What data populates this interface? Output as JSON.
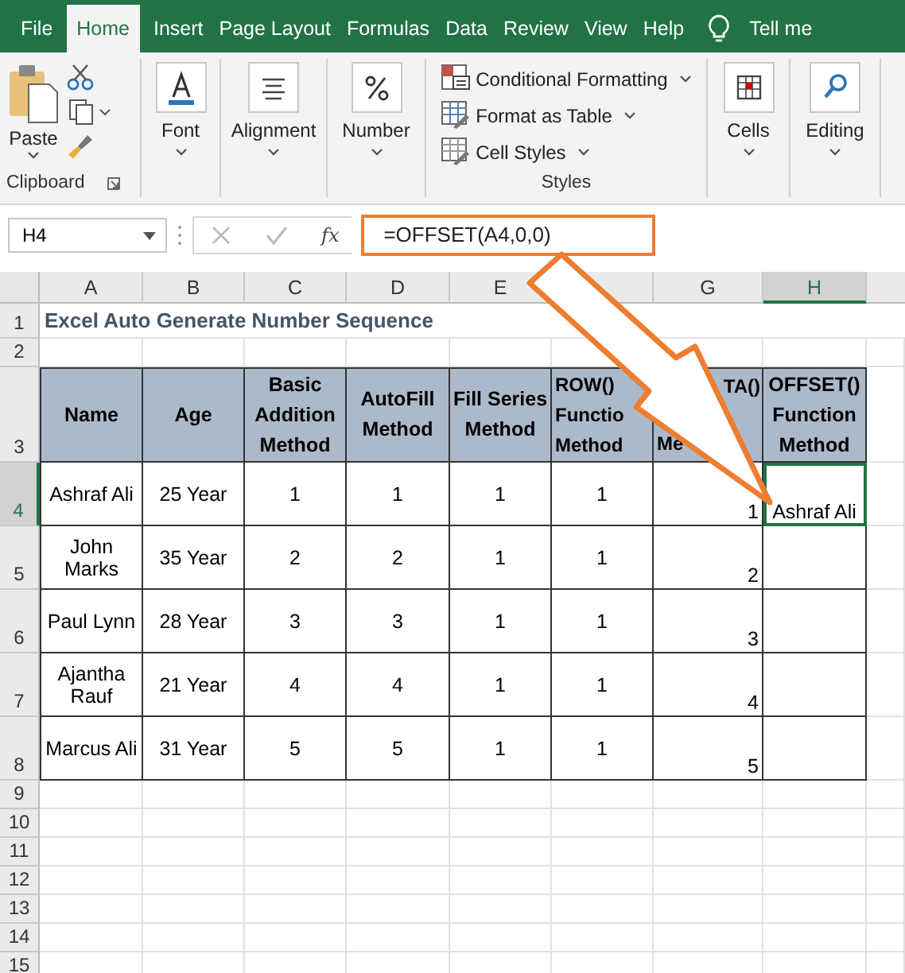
{
  "tabs": [
    {
      "label": "File",
      "selected": false
    },
    {
      "label": "Home",
      "selected": true
    },
    {
      "label": "Insert",
      "selected": false
    },
    {
      "label": "Page Layout",
      "selected": false
    },
    {
      "label": "Formulas",
      "selected": false
    },
    {
      "label": "Data",
      "selected": false
    },
    {
      "label": "Review",
      "selected": false
    },
    {
      "label": "View",
      "selected": false
    },
    {
      "label": "Help",
      "selected": false
    }
  ],
  "tell_me": "Tell me",
  "ribbon": [
    {
      "kind": "clipboard",
      "label": "Clipboard",
      "button": "Paste"
    },
    {
      "kind": "font",
      "label": "Font"
    },
    {
      "kind": "alignment",
      "label": "Alignment"
    },
    {
      "kind": "number",
      "label": "Number"
    },
    {
      "kind": "styles",
      "label": "Styles",
      "items": [
        "Conditional Formatting",
        "Format as Table",
        "Cell Styles"
      ]
    },
    {
      "kind": "cells",
      "label": "Cells"
    },
    {
      "kind": "editing",
      "label": "Editing"
    }
  ],
  "formula_bar": {
    "name_box": "H4",
    "function_label": "fx",
    "formula": "=OFFSET(A4,0,0)"
  },
  "columns": [
    {
      "label": "A",
      "selected": false
    },
    {
      "label": "B",
      "selected": false
    },
    {
      "label": "C",
      "selected": false
    },
    {
      "label": "D",
      "selected": false
    },
    {
      "label": "E",
      "selected": false
    },
    {
      "selected": false
    },
    {
      "label": "G",
      "selected": false
    },
    {
      "label": "H",
      "selected": true
    }
  ],
  "rows": [
    {
      "number": "1",
      "kind": "title",
      "selected": false,
      "title": "Excel Auto Generate Number Sequence"
    },
    {
      "number": "2",
      "kind": "blank",
      "selected": false
    },
    {
      "number": "3",
      "kind": "header",
      "selected": false,
      "cells": [
        [
          "Name"
        ],
        [
          "Age"
        ],
        [
          "Basic Addition Method"
        ],
        [
          "AutoFill Method"
        ],
        [
          "Fill Series Method"
        ],
        [
          "ROW()\nFunctio\nMethod"
        ],
        [
          "TA()",
          "Me"
        ],
        [
          "OFFSET() Function Method"
        ]
      ]
    },
    {
      "number": "4",
      "kind": "data",
      "selected": true,
      "cells": [
        "Ashraf Ali",
        "25 Year",
        "1",
        "1",
        "1",
        "1",
        "1",
        "Ashraf Ali"
      ]
    },
    {
      "number": "5",
      "kind": "data",
      "selected": false,
      "cells": [
        "John Marks",
        "35 Year",
        "2",
        "2",
        "1",
        "1",
        "2",
        ""
      ]
    },
    {
      "number": "6",
      "kind": "data",
      "selected": false,
      "cells": [
        "Paul Lynn",
        "28 Year",
        "3",
        "3",
        "1",
        "1",
        "3",
        ""
      ]
    },
    {
      "number": "7",
      "kind": "data",
      "selected": false,
      "cells": [
        "Ajantha Rauf",
        "21 Year",
        "4",
        "4",
        "1",
        "1",
        "4",
        ""
      ]
    },
    {
      "number": "8",
      "kind": "data",
      "selected": false,
      "cells": [
        "Marcus Ali",
        "31 Year",
        "5",
        "5",
        "1",
        "1",
        "5",
        ""
      ]
    },
    {
      "number": "9",
      "kind": "blank",
      "selected": false
    },
    {
      "number": "10",
      "kind": "blank",
      "selected": false
    },
    {
      "number": "11",
      "kind": "blank",
      "selected": false
    },
    {
      "number": "12",
      "kind": "blank",
      "selected": false
    },
    {
      "number": "13",
      "kind": "blank",
      "selected": false
    },
    {
      "number": "14",
      "kind": "blank",
      "selected": false
    },
    {
      "number": "15",
      "kind": "blank",
      "selected": false
    }
  ]
}
